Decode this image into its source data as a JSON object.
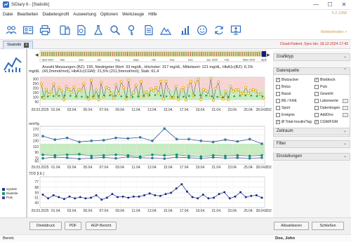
{
  "window": {
    "title": "SiDiary 6 - [Statistik]",
    "minimize": "—",
    "maximize": "☐",
    "close": "✕"
  },
  "menu": [
    "Datei",
    "Bearbeiten",
    "Diabetesprofil",
    "Auswertung",
    "Optionen",
    "Werkzeuge",
    "Hilfe"
  ],
  "version": "6.2.1368",
  "wellbeing": "Wohlbefindlen >",
  "tab": {
    "label": "Statistik",
    "close": "x"
  },
  "cloud_status": "Cloud-Patient, Sync bis: 18.12.2024 17:42",
  "toolbar_icons": [
    "people-icon",
    "id-card-icon",
    "printer-icon",
    "phone-transfer-icon",
    "document-icon",
    "flask-icon",
    "magnifier-icon",
    "key-search-icon",
    "document-lines-icon",
    "mountain-icon",
    "bar-chart-icon",
    "smiley-icon",
    "sync-icon",
    "monitor-person-icon"
  ],
  "timeline_months": [
    "April 2024",
    "Mai",
    "Juni",
    "Juli",
    "Aug.",
    "Sept.",
    "Okt.",
    "Nov.",
    "Dez.",
    "Jan. 2025",
    "Feb.",
    "März 2025",
    "April"
  ],
  "summary": {
    "line1": "Anzahl Messungen (BZ): 155, Niedrigster Wert: 33 mg/dL, Höchster: 317 mg/dL, Mittelwert: 121 mg/dL, HbA1c(BZ): 6,1%",
    "line2": "(43,2mmol/mol), HbA1c(CGM): 21,5% (211,5mmol/mol), Stab: 61,4",
    "unit": "mg/dL"
  },
  "x_tick_labels": [
    "29.03.2025",
    "01.04.",
    "03.04.",
    "05.04.",
    "07.04.",
    "09.04.",
    "11.04.",
    "13.04.",
    "15.04.",
    "17.04.",
    "19.04.",
    "21.04.",
    "23.04.",
    "25.04.",
    "28.04.2025"
  ],
  "chart_data": [
    {
      "type": "scatter",
      "ylabel": "mg/dL",
      "ylim": [
        0,
        320
      ],
      "y_ticks": [
        50,
        100,
        150,
        200,
        250,
        300
      ],
      "target_range": [
        70,
        180
      ],
      "series": [
        {
          "name": "Blutzucker",
          "values": [
            248,
            96,
            187,
            130,
            162,
            246,
            112,
            205,
            176,
            75,
            221,
            186,
            154,
            211,
            107,
            185,
            173,
            249,
            104,
            80,
            288,
            98,
            180,
            74,
            262,
            108,
            205,
            198,
            144,
            92,
            238,
            142,
            269,
            206,
            80,
            288,
            105,
            152,
            233,
            111,
            272,
            114,
            159,
            123,
            191,
            175,
            205,
            148,
            275,
            82,
            272,
            176,
            102,
            98,
            219,
            77,
            178,
            208,
            74,
            223,
            273,
            119,
            263,
            299,
            77,
            185,
            174,
            127,
            307,
            69,
            197,
            267,
            111,
            80,
            165,
            75,
            218,
            168,
            181,
            183,
            141,
            144,
            207,
            143,
            173,
            184,
            171,
            130,
            136,
            95
          ]
        },
        {
          "name": "CGM",
          "values": [
            105,
            110,
            115,
            118,
            120,
            117,
            112,
            108,
            106,
            110,
            116,
            120,
            122,
            118,
            112,
            108,
            106,
            110,
            118,
            124,
            126,
            120,
            112,
            106,
            104,
            108,
            116,
            122,
            125,
            120,
            112,
            106,
            102,
            106,
            112,
            118,
            122,
            120,
            114,
            110
          ]
        }
      ]
    },
    {
      "type": "line",
      "ylabel": "mmHg",
      "ylim": [
        50,
        180
      ],
      "y_ticks": [
        60,
        70,
        90,
        110,
        130,
        150,
        170
      ],
      "target_range": [
        80,
        120
      ],
      "series": [
        {
          "name": "Systole",
          "values": [
            146,
            134,
            140,
            126,
            130,
            132,
            140,
            138,
            142,
            130,
            172,
            136,
            136,
            130,
            126,
            134,
            128,
            136,
            120
          ]
        },
        {
          "name": "Diastole",
          "values": [
            82,
            80,
            82,
            84,
            78,
            80,
            82,
            80,
            76,
            82,
            80,
            82,
            78,
            76,
            80,
            78,
            80,
            78,
            80
          ]
        },
        {
          "name": "Puls",
          "values": [
            70,
            74,
            72,
            68,
            71,
            73,
            70,
            75,
            72,
            71,
            69,
            74,
            72,
            70,
            73,
            71,
            72,
            70,
            72
          ]
        }
      ]
    },
    {
      "type": "line",
      "ylabel": "TDD [I.E.]",
      "ylim": [
        35,
        85
      ],
      "y_ticks": [
        43,
        51,
        59,
        68,
        77
      ],
      "series": [
        {
          "name": "TDD",
          "values": [
            56,
            50,
            55,
            52,
            49,
            53,
            50,
            52,
            50,
            51,
            55,
            48,
            51,
            57,
            52,
            53,
            51,
            53,
            53,
            55,
            58,
            55,
            54,
            57,
            59,
            66,
            73,
            61,
            52,
            50,
            56,
            50,
            51,
            57,
            60,
            50,
            53,
            60,
            52,
            54,
            55,
            51
          ]
        }
      ]
    }
  ],
  "legend": [
    {
      "label": "Systole",
      "color": "#1a3b8a"
    },
    {
      "label": "Diastole",
      "color": "#1a9a6a"
    },
    {
      "label": "Puls",
      "color": "#5a3da0"
    }
  ],
  "right_panel": {
    "graph_type": "Grafiktyp",
    "data_source": "Datenquelle",
    "period": "Zeitraum",
    "filter": "Filter",
    "settings": "Einstellungen",
    "checkboxes": [
      {
        "label": "Blutzucker",
        "checked": true
      },
      {
        "label": "Blutdruck",
        "checked": true
      },
      {
        "label": "Bolus",
        "checked": false
      },
      {
        "label": "Puls",
        "checked": false
      },
      {
        "label": "Basal",
        "checked": false
      },
      {
        "label": "Gewicht",
        "checked": false
      },
      {
        "label": "BE / KHE",
        "checked": false
      },
      {
        "label": "Laborwerte",
        "checked": false
      },
      {
        "label": "Sport",
        "checked": false
      },
      {
        "label": "Datenbogen",
        "checked": false
      },
      {
        "label": "Ereignis",
        "checked": false
      },
      {
        "label": "AddOns",
        "checked": false
      },
      {
        "label": "Ø Total-Insulin/Tag",
        "checked": true
      },
      {
        "label": "CGM/FGM",
        "checked": true
      }
    ],
    "more": "..."
  },
  "buttons": {
    "direct_print": "Direktdruck",
    "pdf": "PDF",
    "agp": "AGP-Bericht",
    "refresh": "Aktualisieren",
    "close": "Schließen"
  },
  "status": {
    "left": "Bereit.",
    "user": "Doe, John"
  },
  "colors": {
    "high_band": "#f6c9c9",
    "target_band": "#c6ecc0",
    "bz_point": "#e3a800",
    "cgm_point": "#2aa24a",
    "line_dark": "#1a1a6a",
    "timeline_bg": "#ece4b0"
  }
}
